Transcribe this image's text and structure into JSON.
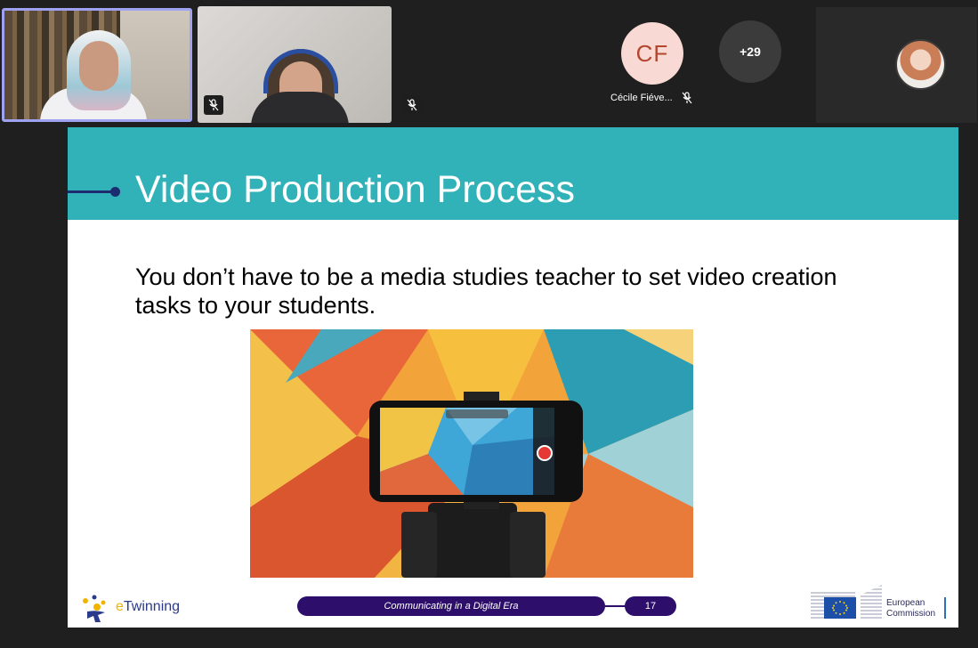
{
  "participants": {
    "tile1": {
      "muted": false
    },
    "tile2": {
      "muted": true
    },
    "cf": {
      "initials": "CF",
      "name": "Cécile Fiéve..."
    },
    "more": {
      "count": "+29"
    }
  },
  "slide": {
    "title": "Video Production Process",
    "body": "You don’t have to be a media studies teacher to set video creation tasks to your students.",
    "footer": {
      "tagline": "Communicating in a Digital Era",
      "page": "17",
      "etwinning_e": "e",
      "etwinning_rest": "Twinning",
      "ec_line1": "European",
      "ec_line2": "Commission"
    }
  },
  "colors": {
    "header": "#31b2b8",
    "accent_navy": "#2d0f6b",
    "cf_avatar": "#f9d9d3",
    "cf_text": "#b3462f",
    "active_speaker_border": "#9ea2f0"
  },
  "icons": [
    "mic-off-icon",
    "mic-off-icon",
    "mic-off-icon"
  ]
}
